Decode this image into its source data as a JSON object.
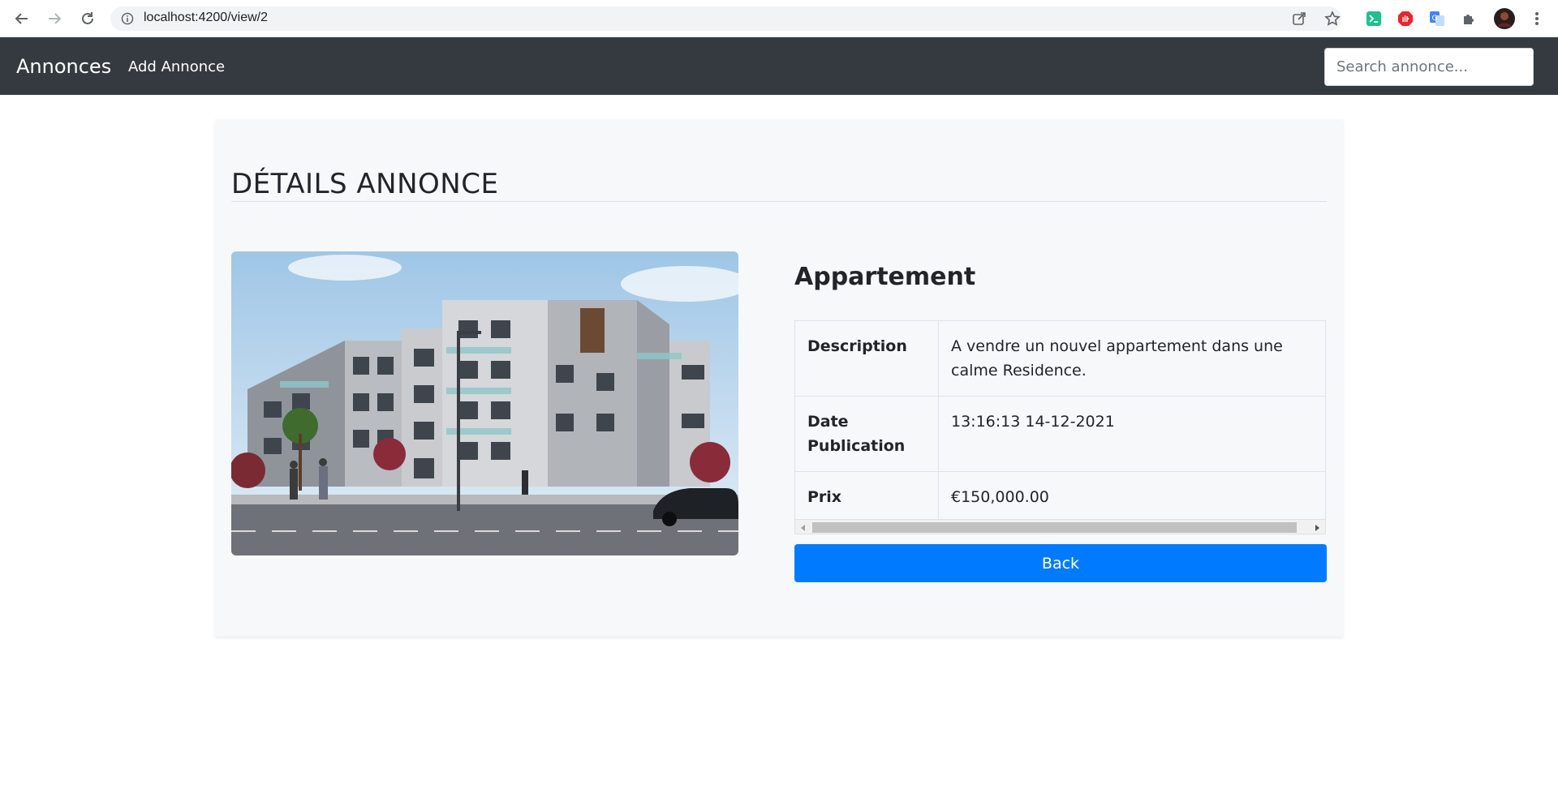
{
  "browser": {
    "url": "localhost:4200/view/2"
  },
  "navbar": {
    "brand": "Annonces",
    "add_link": "Add Annonce",
    "search_placeholder": "Search annonce..."
  },
  "page": {
    "title": "DÉTAILS ANNONCE"
  },
  "annonce": {
    "title": "Appartement",
    "rows": [
      {
        "label": "Description",
        "value": "A vendre un nouvel appartement dans une calme Residence."
      },
      {
        "label": "Date Publication",
        "value": "13:16:13 14-12-2021"
      },
      {
        "label": "Prix",
        "value": "€150,000.00"
      }
    ],
    "back_label": "Back"
  },
  "colors": {
    "navbar": "#343a40",
    "primary": "#007bff",
    "card": "#f7f8f9"
  }
}
